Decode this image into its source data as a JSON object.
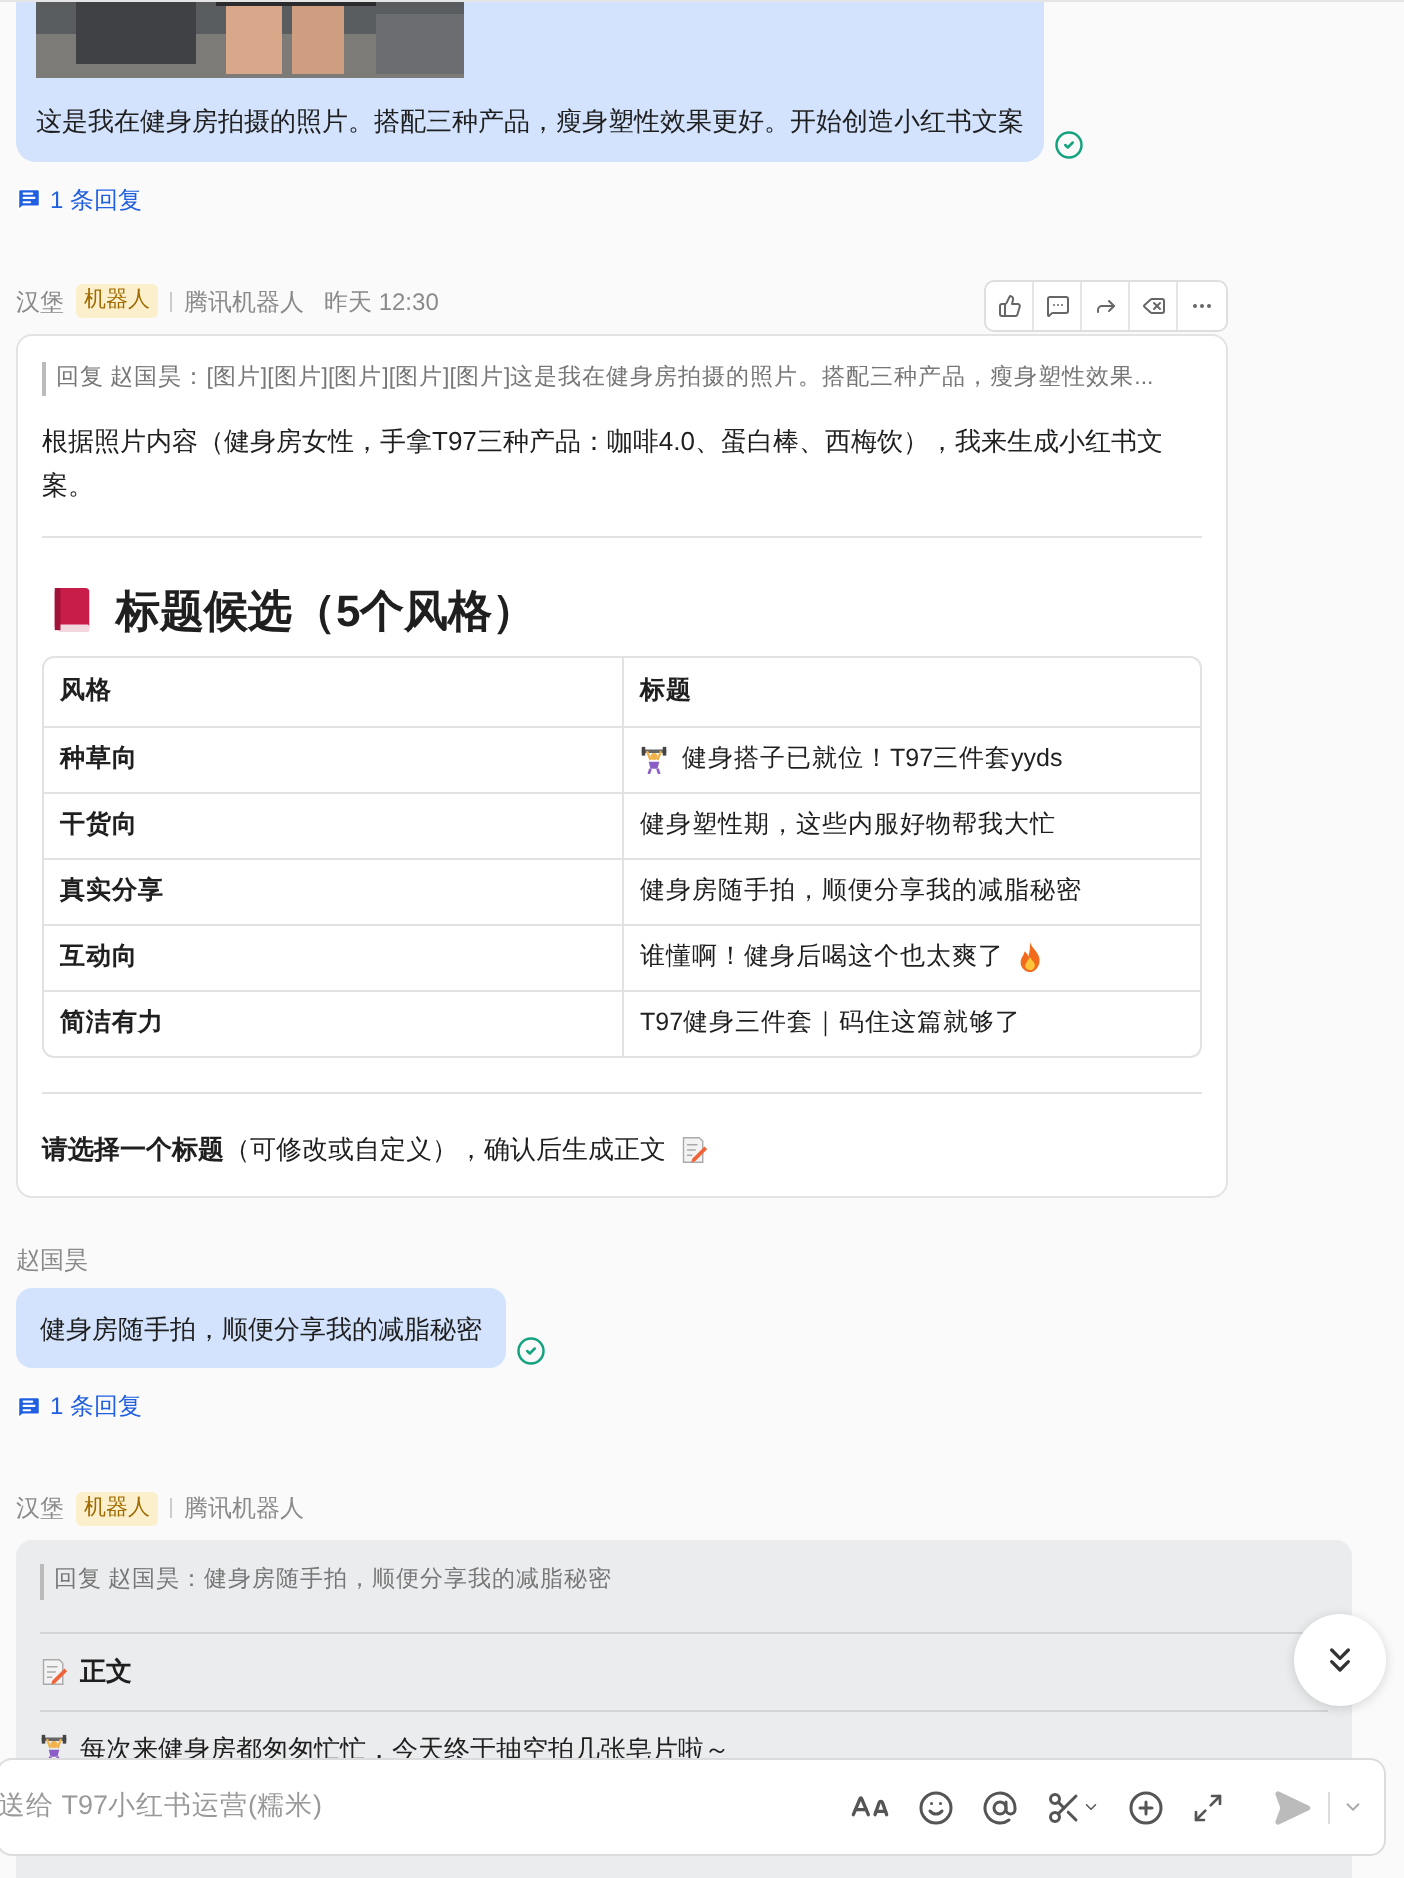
{
  "top_message": {
    "text": "这是我在健身房拍摄的照片。搭配三种产品，瘦身塑性效果更好。开始创造小红书文案",
    "sent": true,
    "reply_link": "1 条回复"
  },
  "bot_message_1": {
    "sender": "汉堡",
    "badge": "机器人",
    "source": "腾讯机器人",
    "time": "昨天 12:30",
    "quote": "回复 赵国昊：[图片][图片][图片][图片][图片]这是我在健身房拍摄的照片。搭配三种产品，瘦身塑性效果...",
    "intro": "根据照片内容（健身房女性，手拿T97三种产品：咖啡4.0、蛋白棒、西梅饮），我来生成小红书文案。",
    "heading": "标题候选（5个风格）",
    "table": {
      "columns": [
        "风格",
        "标题"
      ],
      "rows": [
        {
          "style": "种草向",
          "title": "健身搭子已就位！T97三件套yyds",
          "kind": "lead_icon"
        },
        {
          "style": "干货向",
          "title": "健身塑性期，这些内服好物帮我大忙",
          "kind": "plain"
        },
        {
          "style": "真实分享",
          "title": "健身房随手拍，顺便分享我的减脂秘密",
          "kind": "plain"
        },
        {
          "style": "互动向",
          "title": "谁懂啊！健身后喝这个也太爽了",
          "kind": "trail_icon"
        },
        {
          "style": "简洁有力",
          "title": "T97健身三件套｜码住这篇就够了",
          "kind": "plain"
        }
      ]
    },
    "footer": "**请选择一个标题**（可修改或自定义），确认后生成正文"
  },
  "user_message": {
    "sender": "赵国昊",
    "text": "健身房随手拍，顺便分享我的减脂秘密",
    "sent": true,
    "reply_link": "1 条回复"
  },
  "bot_message_2": {
    "sender": "汉堡",
    "badge": "机器人",
    "source": "腾讯机器人",
    "quote": "回复 赵国昊：健身房随手拍，顺便分享我的减脂秘密",
    "section": "正文",
    "body_line": "每次来健身房都匆匆忙忙，今天终于抽空拍几张皂片啦～"
  },
  "composer": {
    "placeholder": "送给 T97小红书运营(糯米)"
  }
}
